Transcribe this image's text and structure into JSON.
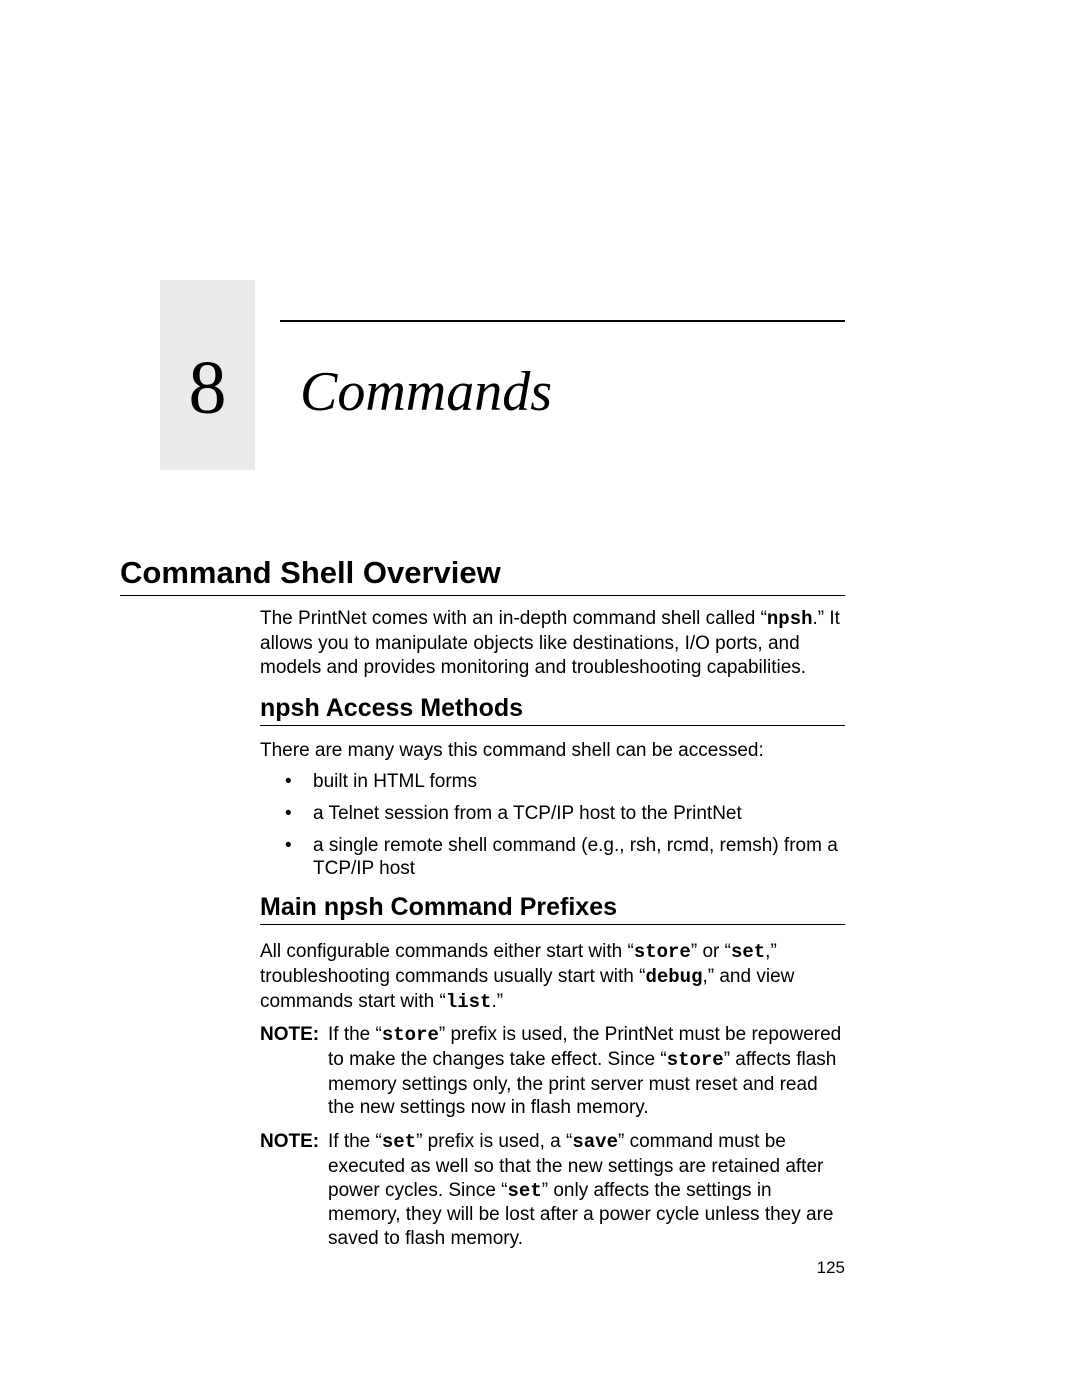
{
  "chapter": {
    "number": "8",
    "title": "Commands"
  },
  "section1": {
    "heading": "Command Shell Overview",
    "para_a": "The PrintNet comes with an in-depth command shell called “",
    "para_b": "npsh",
    "para_c": ".” It allows you to manipulate objects like destinations, I/O ports, and models and provides monitoring and troubleshooting capabilities."
  },
  "section2": {
    "heading": "npsh Access Methods",
    "intro": "There are many ways this command shell can be accessed:",
    "bullets": [
      "built in HTML forms",
      "a Telnet session from a TCP/IP host to the PrintNet",
      "a single remote shell command (e.g., rsh, rcmd, remsh) from a TCP/IP host"
    ]
  },
  "section3": {
    "heading": "Main npsh Command Prefixes",
    "para": {
      "p1": "All configurable commands either start with “",
      "p2": "store",
      "p3": "” or “",
      "p4": "set",
      "p5": ",” troubleshooting commands usually start with “",
      "p6": "debug",
      "p7": ",” and view commands start with “",
      "p8": "list",
      "p9": ".”"
    },
    "note1": {
      "label": "NOTE:",
      "a": "If the “",
      "b": "store",
      "c": "” prefix is used, the PrintNet must be repowered to make the changes take effect. Since “",
      "d": "store",
      "e": "” affects flash memory settings only, the print server must reset and read the new settings now in flash memory."
    },
    "note2": {
      "label": "NOTE:",
      "a": "If the “",
      "b": "set",
      "c": "” prefix is used, a “",
      "d": "save",
      "e": "” command must be executed as well so that the new settings are retained after power cycles. Since “",
      "f": "set",
      "g": "” only affects the settings in memory, they will be lost after a power cycle unless they are saved to flash memory."
    }
  },
  "pageNumber": "125"
}
